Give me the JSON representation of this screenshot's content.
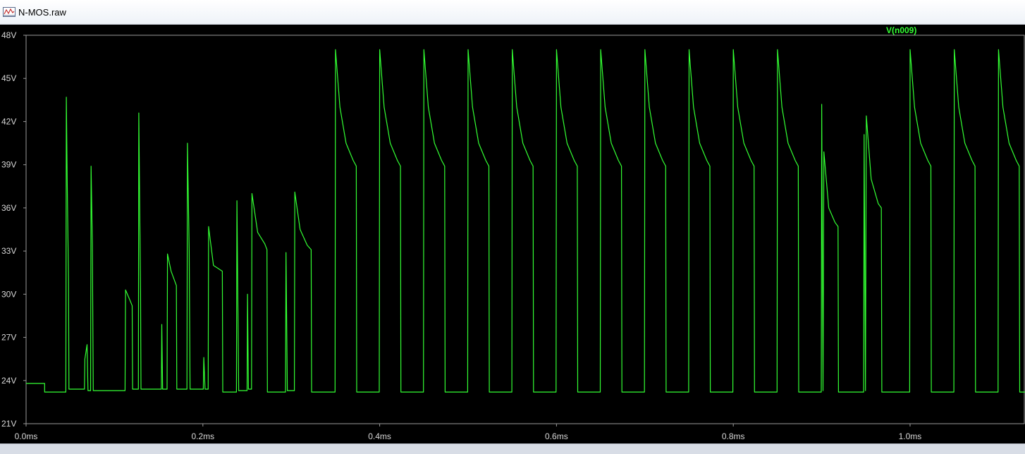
{
  "window": {
    "title": "N-MOS.raw",
    "icon": "waveform-icon"
  },
  "colors": {
    "trace": "#33ff33",
    "background": "#000000",
    "axis_text": "#d8d8d8",
    "frame": "#9a9a9a"
  },
  "chart_data": {
    "type": "line",
    "title": "",
    "xlabel": "",
    "ylabel": "",
    "xlim": [
      0.0,
      1.13
    ],
    "ylim": [
      21,
      48
    ],
    "x_ticks": [
      "0.0ms",
      "0.2ms",
      "0.4ms",
      "0.6ms",
      "0.8ms",
      "1.0ms"
    ],
    "y_ticks": [
      "21V",
      "24V",
      "27V",
      "30V",
      "33V",
      "36V",
      "39V",
      "42V",
      "45V",
      "48V"
    ],
    "grid": false,
    "legend": "top-right",
    "series": [
      {
        "name": "V(n009)",
        "x_unit": "ms",
        "y_unit": "V",
        "points": [
          [
            0.0,
            23.8
          ],
          [
            0.021,
            23.8
          ],
          [
            0.021,
            23.2
          ],
          [
            0.045,
            23.2
          ],
          [
            0.0455,
            43.7
          ],
          [
            0.0465,
            38.0
          ],
          [
            0.048,
            31.0
          ],
          [
            0.0485,
            23.4
          ],
          [
            0.066,
            23.4
          ],
          [
            0.0665,
            25.5
          ],
          [
            0.069,
            26.5
          ],
          [
            0.07,
            23.3
          ],
          [
            0.073,
            23.3
          ],
          [
            0.0735,
            38.9
          ],
          [
            0.075,
            33.5
          ],
          [
            0.076,
            23.3
          ],
          [
            0.112,
            23.3
          ],
          [
            0.1125,
            30.3
          ],
          [
            0.118,
            29.5
          ],
          [
            0.12,
            29.2
          ],
          [
            0.1205,
            23.4
          ],
          [
            0.127,
            23.4
          ],
          [
            0.1275,
            42.6
          ],
          [
            0.1295,
            30.0
          ],
          [
            0.13,
            23.4
          ],
          [
            0.153,
            23.4
          ],
          [
            0.1535,
            27.9
          ],
          [
            0.1545,
            23.4
          ],
          [
            0.1595,
            23.4
          ],
          [
            0.16,
            32.8
          ],
          [
            0.164,
            31.6
          ],
          [
            0.17,
            30.6
          ],
          [
            0.1705,
            23.4
          ],
          [
            0.182,
            23.4
          ],
          [
            0.1825,
            40.5
          ],
          [
            0.1845,
            33.0
          ],
          [
            0.1855,
            23.4
          ],
          [
            0.2005,
            23.4
          ],
          [
            0.201,
            25.6
          ],
          [
            0.2025,
            23.4
          ],
          [
            0.206,
            23.4
          ],
          [
            0.2065,
            34.7
          ],
          [
            0.212,
            32.0
          ],
          [
            0.222,
            31.6
          ],
          [
            0.2225,
            23.2
          ],
          [
            0.238,
            23.2
          ],
          [
            0.2385,
            36.5
          ],
          [
            0.2405,
            23.3
          ],
          [
            0.25,
            23.3
          ],
          [
            0.2505,
            30.0
          ],
          [
            0.2515,
            23.4
          ],
          [
            0.255,
            23.4
          ],
          [
            0.2555,
            37.0
          ],
          [
            0.262,
            34.3
          ],
          [
            0.27,
            33.5
          ],
          [
            0.2725,
            33.1
          ],
          [
            0.273,
            23.2
          ],
          [
            0.2935,
            23.2
          ],
          [
            0.294,
            32.9
          ],
          [
            0.2955,
            23.3
          ],
          [
            0.3035,
            23.3
          ],
          [
            0.304,
            37.1
          ],
          [
            0.31,
            34.5
          ],
          [
            0.318,
            33.4
          ],
          [
            0.3225,
            33.1
          ],
          [
            0.323,
            23.2
          ],
          [
            0.3495,
            23.2
          ],
          [
            0.35,
            47.0
          ],
          [
            0.355,
            43.0
          ],
          [
            0.362,
            40.5
          ],
          [
            0.37,
            39.3
          ],
          [
            0.3735,
            38.9
          ],
          [
            0.374,
            23.2
          ],
          [
            0.3995,
            23.2
          ],
          [
            0.4,
            47.0
          ],
          [
            0.405,
            43.0
          ],
          [
            0.412,
            40.5
          ],
          [
            0.42,
            39.3
          ],
          [
            0.4235,
            38.9
          ],
          [
            0.424,
            23.2
          ],
          [
            0.4495,
            23.2
          ],
          [
            0.45,
            47.0
          ],
          [
            0.455,
            43.0
          ],
          [
            0.462,
            40.5
          ],
          [
            0.47,
            39.3
          ],
          [
            0.4735,
            38.9
          ],
          [
            0.474,
            23.2
          ],
          [
            0.4995,
            23.2
          ],
          [
            0.5,
            47.0
          ],
          [
            0.505,
            43.0
          ],
          [
            0.512,
            40.5
          ],
          [
            0.52,
            39.3
          ],
          [
            0.5235,
            38.9
          ],
          [
            0.524,
            23.2
          ],
          [
            0.5495,
            23.2
          ],
          [
            0.55,
            47.0
          ],
          [
            0.555,
            43.0
          ],
          [
            0.562,
            40.5
          ],
          [
            0.57,
            39.3
          ],
          [
            0.5735,
            38.9
          ],
          [
            0.574,
            23.2
          ],
          [
            0.5995,
            23.2
          ],
          [
            0.6,
            47.0
          ],
          [
            0.605,
            43.0
          ],
          [
            0.612,
            40.5
          ],
          [
            0.62,
            39.3
          ],
          [
            0.6235,
            38.9
          ],
          [
            0.624,
            23.2
          ],
          [
            0.6495,
            23.2
          ],
          [
            0.65,
            47.0
          ],
          [
            0.655,
            43.0
          ],
          [
            0.662,
            40.5
          ],
          [
            0.67,
            39.3
          ],
          [
            0.6735,
            38.9
          ],
          [
            0.674,
            23.2
          ],
          [
            0.6995,
            23.2
          ],
          [
            0.7,
            47.0
          ],
          [
            0.705,
            43.0
          ],
          [
            0.712,
            40.5
          ],
          [
            0.72,
            39.3
          ],
          [
            0.7235,
            38.9
          ],
          [
            0.724,
            23.2
          ],
          [
            0.7495,
            23.2
          ],
          [
            0.75,
            47.0
          ],
          [
            0.755,
            43.0
          ],
          [
            0.762,
            40.5
          ],
          [
            0.77,
            39.3
          ],
          [
            0.7735,
            38.9
          ],
          [
            0.774,
            23.2
          ],
          [
            0.7995,
            23.2
          ],
          [
            0.8,
            47.0
          ],
          [
            0.805,
            43.0
          ],
          [
            0.812,
            40.5
          ],
          [
            0.82,
            39.3
          ],
          [
            0.8235,
            38.9
          ],
          [
            0.824,
            23.2
          ],
          [
            0.8495,
            23.2
          ],
          [
            0.85,
            47.0
          ],
          [
            0.855,
            43.0
          ],
          [
            0.862,
            40.5
          ],
          [
            0.87,
            39.3
          ],
          [
            0.8735,
            38.9
          ],
          [
            0.874,
            23.2
          ],
          [
            0.8995,
            23.2
          ],
          [
            0.9,
            43.2
          ],
          [
            0.9015,
            23.3
          ],
          [
            0.9025,
            39.9
          ],
          [
            0.908,
            36.0
          ],
          [
            0.915,
            35.0
          ],
          [
            0.9185,
            34.7
          ],
          [
            0.919,
            23.2
          ],
          [
            0.9475,
            23.2
          ],
          [
            0.948,
            41.1
          ],
          [
            0.9495,
            23.3
          ],
          [
            0.9505,
            42.4
          ],
          [
            0.956,
            38.0
          ],
          [
            0.964,
            36.3
          ],
          [
            0.9675,
            36.0
          ],
          [
            0.968,
            23.2
          ],
          [
            0.9995,
            23.2
          ],
          [
            1.0,
            47.0
          ],
          [
            1.005,
            43.0
          ],
          [
            1.012,
            40.5
          ],
          [
            1.02,
            39.3
          ],
          [
            1.0235,
            38.9
          ],
          [
            1.024,
            23.2
          ],
          [
            1.0495,
            23.2
          ],
          [
            1.05,
            47.0
          ],
          [
            1.055,
            43.0
          ],
          [
            1.062,
            40.5
          ],
          [
            1.07,
            39.3
          ],
          [
            1.0735,
            38.9
          ],
          [
            1.074,
            23.2
          ],
          [
            1.0995,
            23.2
          ],
          [
            1.1,
            47.0
          ],
          [
            1.105,
            43.0
          ],
          [
            1.112,
            40.5
          ],
          [
            1.12,
            39.3
          ],
          [
            1.1235,
            38.9
          ],
          [
            1.124,
            23.2
          ],
          [
            1.13,
            23.2
          ]
        ]
      }
    ]
  }
}
